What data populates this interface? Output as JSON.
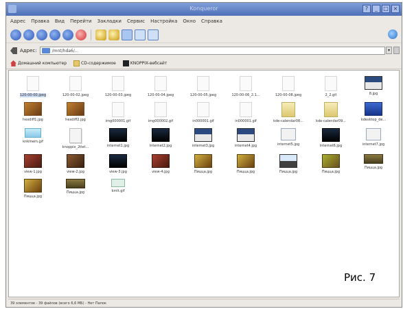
{
  "window": {
    "title": "Konqueror"
  },
  "menubar": [
    "Адрес",
    "Правка",
    "Вид",
    "Перейти",
    "Закладки",
    "Сервис",
    "Настройка",
    "Окно",
    "Справка"
  ],
  "toolbar": {
    "buttons": [
      {
        "icon": "zoom-in-icon",
        "group": "zoom"
      },
      {
        "icon": "zoom-out-icon",
        "group": "zoom"
      },
      {
        "icon": "zoom-fit-icon",
        "group": "zoom"
      },
      {
        "icon": "zoom-reset-icon",
        "group": "zoom"
      },
      {
        "icon": "reload-icon",
        "group": "nav"
      },
      {
        "icon": "stop-icon",
        "group": "nav"
      },
      {
        "icon": "separator",
        "group": "sep"
      },
      {
        "icon": "find-icon",
        "group": "find"
      },
      {
        "icon": "find-next-icon",
        "group": "find"
      },
      {
        "icon": "icon-view-icon",
        "group": "view",
        "active": true
      },
      {
        "icon": "detail-view-icon",
        "group": "view"
      },
      {
        "icon": "tree-view-icon",
        "group": "view"
      }
    ]
  },
  "address": {
    "label": "Адрес:",
    "value": "/mnt/hda6/..."
  },
  "bookmarks": [
    {
      "icon": "home-icon",
      "label": "Домашний компьютер"
    },
    {
      "icon": "cd-icon",
      "label": "CD-содержимое"
    },
    {
      "icon": "knoppix-icon",
      "label": "KNOPPIX-вебсайт"
    }
  ],
  "files": [
    {
      "name": "120-00-00.jpeg",
      "thumb": "t-page",
      "selected": true
    },
    {
      "name": "120-00-02.jpeg",
      "thumb": "t-page"
    },
    {
      "name": "120-00-03.jpeg",
      "thumb": "t-page"
    },
    {
      "name": "120-00-04.jpeg",
      "thumb": "t-page"
    },
    {
      "name": "120-00-05.jpeg",
      "thumb": "t-page"
    },
    {
      "name": "120-00-06_2.1...",
      "thumb": "t-page"
    },
    {
      "name": "120-00-08.jpeg",
      "thumb": "t-page"
    },
    {
      "name": "2_2.gif",
      "thumb": "t-page"
    },
    {
      "name": "8.jpg",
      "thumb": "t-screen"
    },
    {
      "name": "hexdiff1.jpg",
      "thumb": "t-photo"
    },
    {
      "name": "hexdiff2.jpg",
      "thumb": "t-photo"
    },
    {
      "name": "img000001.gif",
      "thumb": "t-page"
    },
    {
      "name": "img000002.gif",
      "thumb": "t-page"
    },
    {
      "name": "in000001.gif",
      "thumb": "t-page"
    },
    {
      "name": "in000001.gif",
      "thumb": "t-page"
    },
    {
      "name": "kde-calendar08...",
      "thumb": "t-yellow"
    },
    {
      "name": "kde-calendar09...",
      "thumb": "t-yellow"
    },
    {
      "name": "kdesktop_de...",
      "thumb": "t-blue"
    },
    {
      "name": "knkmem.gif",
      "thumb": "t-cyan"
    },
    {
      "name": "knoppix_2tlet...",
      "thumb": "t-doc"
    },
    {
      "name": "internet1.jpg",
      "thumb": "t-dark"
    },
    {
      "name": "internet2.jpg",
      "thumb": "t-dark"
    },
    {
      "name": "internet3.jpg",
      "thumb": "t-screen"
    },
    {
      "name": "internet4.jpg",
      "thumb": "t-screen"
    },
    {
      "name": "internet5.jpg",
      "thumb": "t-greyframe"
    },
    {
      "name": "internet6.jpg",
      "thumb": "t-dark"
    },
    {
      "name": "internet7.jpg",
      "thumb": "t-greyframe"
    },
    {
      "name": "view-1.jpg",
      "thumb": "t-red"
    },
    {
      "name": "view-2.jpg",
      "thumb": "t-brown"
    },
    {
      "name": "view-3.jpg",
      "thumb": "t-dark"
    },
    {
      "name": "view-4.jpg",
      "thumb": "t-red"
    },
    {
      "name": "Пицца.jpg",
      "thumb": "t-yelphoto"
    },
    {
      "name": "Пицца.jpg",
      "thumb": "t-yelphoto"
    },
    {
      "name": "Пицца.jpg",
      "thumb": "t-sky"
    },
    {
      "name": "Пицца.jpg",
      "thumb": "t-gallery"
    },
    {
      "name": "Пицца.jpg",
      "thumb": "t-olive"
    },
    {
      "name": "Пицца.jpg",
      "thumb": "t-yelphoto"
    },
    {
      "name": "Пицца.jpg",
      "thumb": "t-olive"
    },
    {
      "name": "kmlt.gif",
      "thumb": "t-mini"
    }
  ],
  "caption": "Рис. 7",
  "status": "39 элементов - 39 файлов (всего 6,6 MБ) - Нет Папок"
}
